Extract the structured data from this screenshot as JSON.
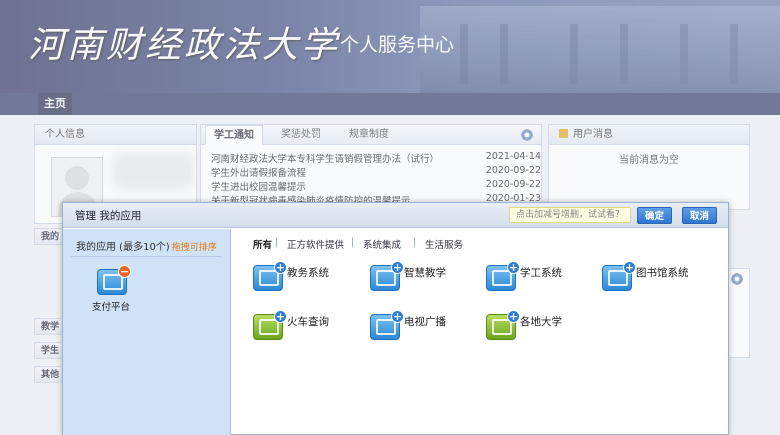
{
  "banner": {
    "university": "河南财经政法大学",
    "center_title": "个人服务中心"
  },
  "nav": {
    "home": "主页"
  },
  "personal_info": {
    "title": "个人信息"
  },
  "notice": {
    "tabs": [
      "学工通知",
      "奖惩处罚",
      "规章制度"
    ],
    "items": [
      {
        "title": "河南财经政法大学本专科学生请销假管理办法（试行）",
        "date": "2021-04-14"
      },
      {
        "title": "学生外出请假报备流程",
        "date": "2020-09-22"
      },
      {
        "title": "学生进出校园温馨提示",
        "date": "2020-09-22"
      },
      {
        "title": "关于新型冠状病毒感染肺炎疫情防控的温馨提示",
        "date": "2020-01-23"
      }
    ]
  },
  "user_msg": {
    "title": "用户消息",
    "empty": "当前消息为空"
  },
  "side_menu": {
    "my": "我的",
    "teaching": "教学",
    "student": "学生",
    "other": "其他"
  },
  "modal": {
    "title": "管理 我的应用",
    "search_hint": "点击加减号增删，试试看？",
    "confirm": "确定",
    "cancel": "取消",
    "my_apps_header": "我的应用 (最多10个)",
    "sort_hint": "拖拽可排序",
    "my_apps": [
      {
        "label": "支付平台"
      }
    ],
    "filters": [
      "所有",
      "正方软件提供",
      "系统集成",
      "生活服务"
    ],
    "apps": [
      {
        "label": "教务系统",
        "color": "#2c88d6"
      },
      {
        "label": "智慧教学",
        "color": "#2c88d6"
      },
      {
        "label": "学工系统",
        "color": "#2c88d6"
      },
      {
        "label": "图书馆系统",
        "color": "#2c88d6"
      },
      {
        "label": "火车查询",
        "color": "#6aa51f"
      },
      {
        "label": "电视广播",
        "color": "#2c88d6"
      },
      {
        "label": "各地大学",
        "color": "#6aa51f"
      }
    ]
  }
}
